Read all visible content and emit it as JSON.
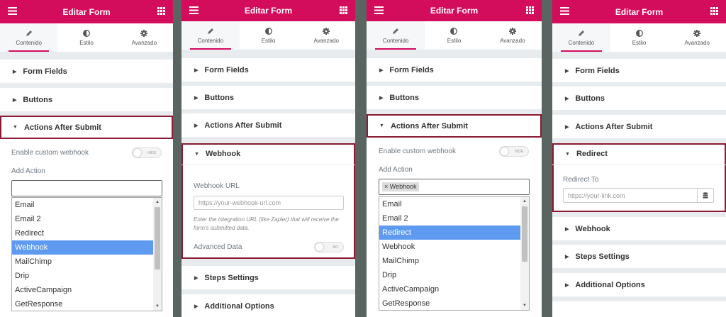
{
  "header_title": "Editar Form",
  "tabs": {
    "content": "Contenido",
    "style": "Estilo",
    "advanced": "Avanzado"
  },
  "sections": {
    "form_fields": "Form Fields",
    "buttons": "Buttons",
    "actions_after_submit": "Actions After Submit",
    "webhook": "Webhook",
    "redirect": "Redirect",
    "steps_settings": "Steps Settings",
    "additional_options": "Additional Options"
  },
  "enable_webhook_label": "Enable custom webhook",
  "toggle_hide": "HIDE",
  "toggle_no": "NO",
  "add_action_label": "Add Action",
  "actions_options": [
    "Email",
    "Email 2",
    "Redirect",
    "Webhook",
    "MailChimp",
    "Drip",
    "ActiveCampaign",
    "GetResponse"
  ],
  "panel1_selected": "Webhook",
  "panel3_selected": "Redirect",
  "selected_chip": "× Webhook",
  "webhook_url_label": "Webhook URL",
  "webhook_url_placeholder": "https://your-webhook-url.com",
  "webhook_help": "Enter the integration URL (like Zapier) that will receive the form's submitted data.",
  "advanced_data_label": "Advanced Data",
  "redirect_to_label": "Redirect To",
  "redirect_placeholder": "https://your-link.com",
  "colors": {
    "brand": "#d30c5c",
    "highlight": "#8b1a32",
    "selected": "#5e9bf0"
  }
}
